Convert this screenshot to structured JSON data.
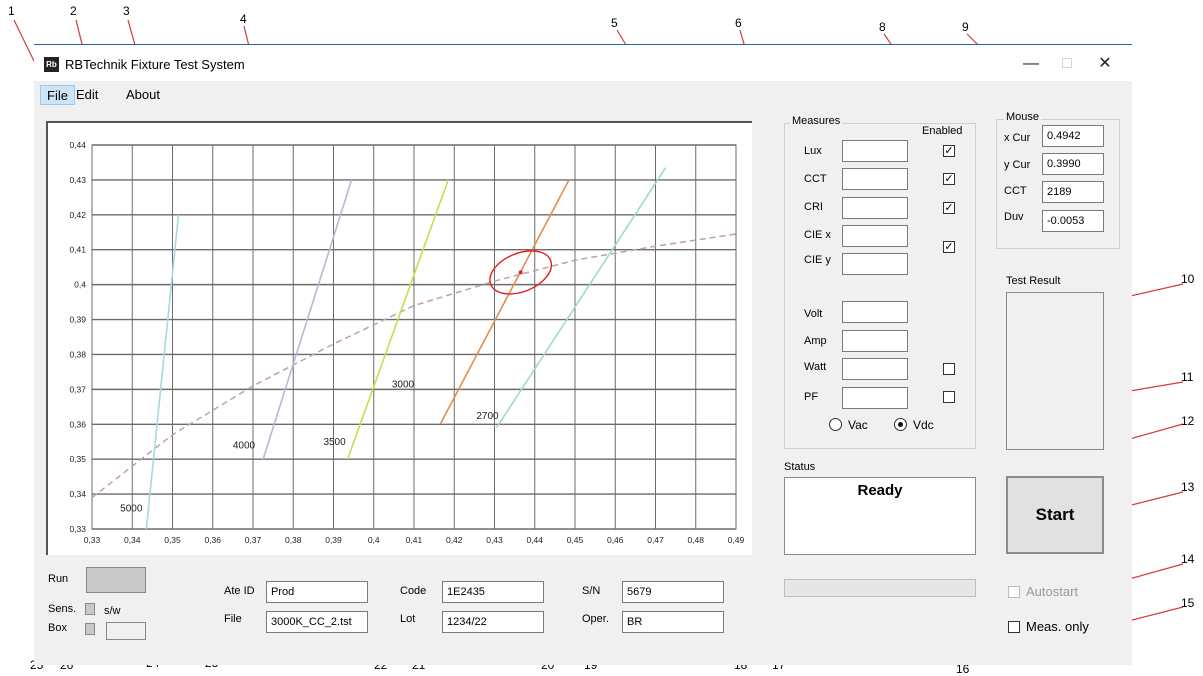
{
  "window": {
    "title": "RBTechnik Fixture Test System",
    "icon_text": "Rb",
    "controls": {
      "minimize": "—",
      "maximize": "□",
      "close": "✕"
    }
  },
  "menu": [
    "File",
    "Edit",
    "About"
  ],
  "callouts": [
    "1",
    "2",
    "3",
    "4",
    "5",
    "6",
    "8",
    "9",
    "10",
    "11",
    "12",
    "13",
    "14",
    "15",
    "16",
    "17",
    "18",
    "19",
    "20",
    "21",
    "22",
    "23",
    "24",
    "25",
    "26"
  ],
  "chart_data": {
    "type": "line",
    "x_ticks": [
      "0,33",
      "0,34",
      "0,35",
      "0,36",
      "0,37",
      "0,38",
      "0,39",
      "0,4",
      "0,41",
      "0,42",
      "0,43",
      "0,44",
      "0,45",
      "0,46",
      "0,47",
      "0,48",
      "0,49"
    ],
    "y_ticks": [
      "0,33",
      "0,34",
      "0,35",
      "0,36",
      "0,37",
      "0,38",
      "0,39",
      "0,4",
      "0,41",
      "0,42",
      "0,43",
      "0,44"
    ],
    "xlim": [
      0.33,
      0.49
    ],
    "ylim": [
      0.33,
      0.44
    ],
    "grid": true,
    "series": [
      {
        "name": "5000",
        "color": "#a8d8e0",
        "points": [
          [
            0.3435,
            0.33
          ],
          [
            0.3515,
            0.42
          ]
        ],
        "label_at": [
          0.337,
          0.335
        ]
      },
      {
        "name": "4000",
        "color": "#b8b8d8",
        "points": [
          [
            0.3725,
            0.35
          ],
          [
            0.3945,
            0.43
          ]
        ],
        "label_at": [
          0.365,
          0.353
        ]
      },
      {
        "name": "3500",
        "color": "#c8de50",
        "points": [
          [
            0.3935,
            0.35
          ],
          [
            0.4185,
            0.43
          ]
        ],
        "label_at": [
          0.3875,
          0.354
        ]
      },
      {
        "name": "3000",
        "color": "#e09050",
        "points": [
          [
            0.4165,
            0.36
          ],
          [
            0.4485,
            0.43
          ]
        ],
        "label_at": [
          0.4045,
          0.3705
        ]
      },
      {
        "name": "2700",
        "color": "#a0d8d0",
        "points": [
          [
            0.4305,
            0.359
          ],
          [
            0.4725,
            0.4335
          ]
        ],
        "label_at": [
          0.4255,
          0.3615
        ]
      }
    ],
    "planckian_locus": {
      "color": "#c0a0a8",
      "points": [
        [
          0.33,
          0.339
        ],
        [
          0.35,
          0.357
        ],
        [
          0.37,
          0.371
        ],
        [
          0.39,
          0.383
        ],
        [
          0.41,
          0.394
        ],
        [
          0.43,
          0.401
        ],
        [
          0.45,
          0.407
        ],
        [
          0.47,
          0.411
        ],
        [
          0.49,
          0.4145
        ]
      ]
    },
    "target_ellipse": {
      "center": [
        0.4365,
        0.4035
      ],
      "rx": 0.008,
      "ry": 0.0055,
      "color": "#e02020"
    },
    "marker": [
      0.4365,
      0.4035
    ]
  },
  "measures": {
    "title": "Measures",
    "enabled_label": "Enabled",
    "rows": [
      {
        "label": "Lux",
        "value": "",
        "checked": true
      },
      {
        "label": "CCT",
        "value": "",
        "checked": true
      },
      {
        "label": "CRI",
        "value": "",
        "checked": true
      },
      {
        "label": "CIE x",
        "value": "",
        "checked": true
      },
      {
        "label": "CIE y",
        "value": ""
      },
      {
        "label": "Volt",
        "value": ""
      },
      {
        "label": "Amp",
        "value": ""
      },
      {
        "label": "Watt",
        "value": "",
        "checked": false
      },
      {
        "label": "PF",
        "value": "",
        "checked": false
      }
    ],
    "radio": [
      {
        "label": "Vac",
        "selected": false
      },
      {
        "label": "Vdc",
        "selected": true
      }
    ]
  },
  "mouse": {
    "title": "Mouse",
    "fields": [
      {
        "label": "x Cur",
        "value": "0.4942"
      },
      {
        "label": "y Cur",
        "value": "0.3990"
      },
      {
        "label": "CCT",
        "value": "2189"
      },
      {
        "label": "Duv",
        "value": "-0.0053"
      }
    ]
  },
  "test_result": {
    "label": "Test Result"
  },
  "status": {
    "label": "Status",
    "text": "Ready"
  },
  "start_button": "Start",
  "autostart": {
    "label": "Autostart",
    "checked": false,
    "enabled": false
  },
  "meas_only": {
    "label": "Meas. only",
    "checked": false
  },
  "bottom": {
    "run_label": "Run",
    "sens_label": "Sens.",
    "box_label": "Box",
    "sw_label": "s/w",
    "ate_id": {
      "label": "Ate ID",
      "value": "Prod"
    },
    "file": {
      "label": "File",
      "value": "3000K_CC_2.tst"
    },
    "code": {
      "label": "Code",
      "value": "1E2435"
    },
    "lot": {
      "label": "Lot",
      "value": "1234/22"
    },
    "sn": {
      "label": "S/N",
      "value": "5679"
    },
    "oper": {
      "label": "Oper.",
      "value": "BR"
    }
  }
}
